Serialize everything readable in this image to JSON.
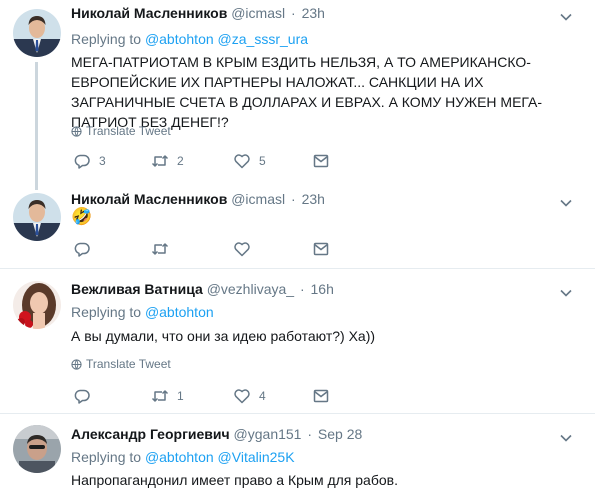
{
  "tweets": [
    {
      "name": "Николай Масленников",
      "handle": "@icmasl",
      "time": "23h",
      "reply_label": "Replying to",
      "reply_users": [
        "@abtohton",
        "@za_sssr_ura"
      ],
      "text": "МЕГА-ПАТРИОТАМ В КРЫМ ЕЗДИТЬ НЕЛЬЗЯ, А ТО АМЕРИКАНСКО-ЕВРОПЕЙСКИЕ ИХ ПАРТНЕРЫ НАЛОЖАТ... САНКЦИИ НА ИХ ЗАГРАНИЧНЫЕ СЧЕТА В ДОЛЛАРАХ И ЕВРАХ. А КОМУ НУЖЕН МЕГА-ПАТРИОТ БЕЗ ДЕНЕГ!?",
      "translate": "Translate Tweet",
      "replies": "3",
      "retweets": "2",
      "likes": "5"
    },
    {
      "name": "Николай Масленников",
      "handle": "@icmasl",
      "time": "23h",
      "text": "🤣",
      "replies": "",
      "retweets": "",
      "likes": ""
    },
    {
      "name": "Вежливая Ватница",
      "handle": "@vezhlivaya_",
      "time": "16h",
      "reply_label": "Replying to",
      "reply_users": [
        "@abtohton"
      ],
      "text": "А вы думали, что они за идею работают?) Ха))",
      "translate": "Translate Tweet",
      "replies": "",
      "retweets": "1",
      "likes": "4"
    },
    {
      "name": "Александр Георгиевич",
      "handle": "@ygan151",
      "time": "Sep 28",
      "reply_label": "Replying to",
      "reply_users": [
        "@abtohton",
        "@Vitalin25K"
      ],
      "text": "Напропагандонил имеет право а Крым для рабов."
    }
  ],
  "colors": {
    "link": "#1da1f2",
    "muted": "#657786",
    "border": "#e6ecf0",
    "thread": "#ccd6dd"
  },
  "icons": [
    "reply-icon",
    "retweet-icon",
    "like-icon",
    "message-icon",
    "globe-icon",
    "chevron-down-icon"
  ]
}
